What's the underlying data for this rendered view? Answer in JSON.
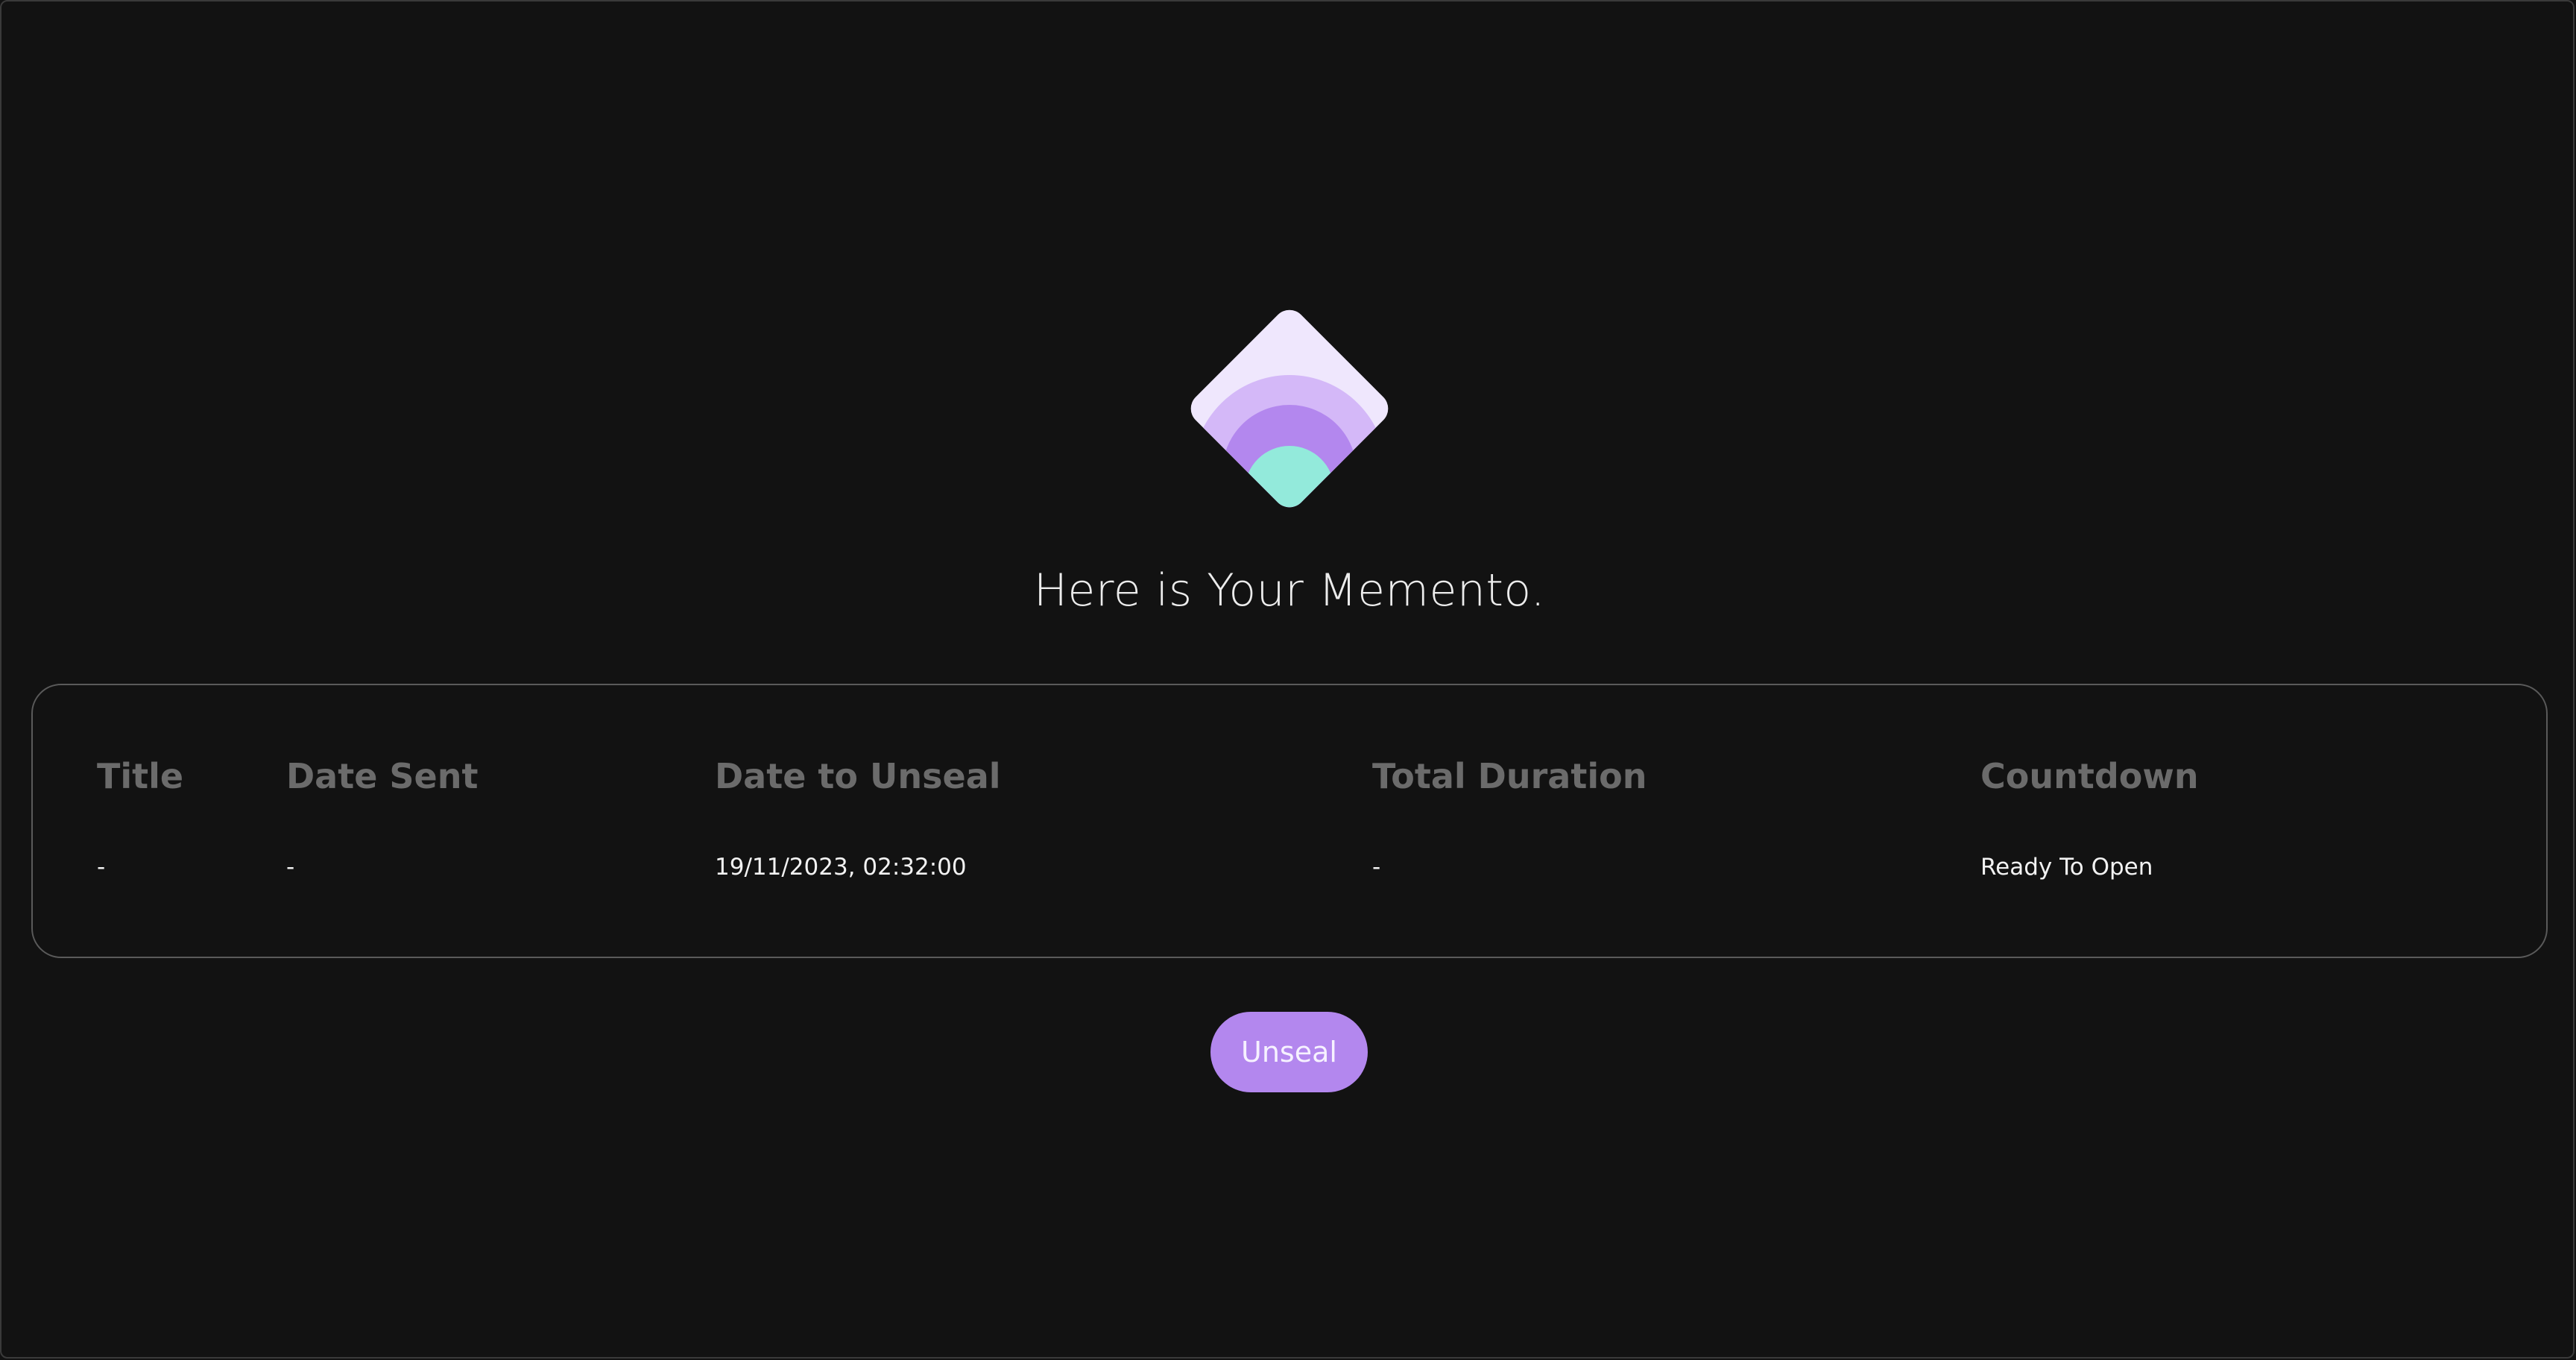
{
  "app": {
    "heading": "Here is Your Memento.",
    "logo_icon": "memento-diamond-logo-icon"
  },
  "colors": {
    "background": "#121212",
    "logo_diamond": "#efe7fd",
    "logo_arc_outer": "#d4b8f8",
    "logo_arc_mid": "#b387ee",
    "logo_core": "#93eadb",
    "button": "#b387ee",
    "header_text": "#6b6b6b"
  },
  "table": {
    "columns": [
      {
        "header": "Title",
        "value": "-"
      },
      {
        "header": "Date Sent",
        "value": "-"
      },
      {
        "header": "Date to Unseal",
        "value": "19/11/2023, 02:32:00"
      },
      {
        "header": "Total Duration",
        "value": "-"
      },
      {
        "header": "Countdown",
        "value": "Ready To Open"
      }
    ]
  },
  "actions": {
    "unseal_label": "Unseal"
  }
}
